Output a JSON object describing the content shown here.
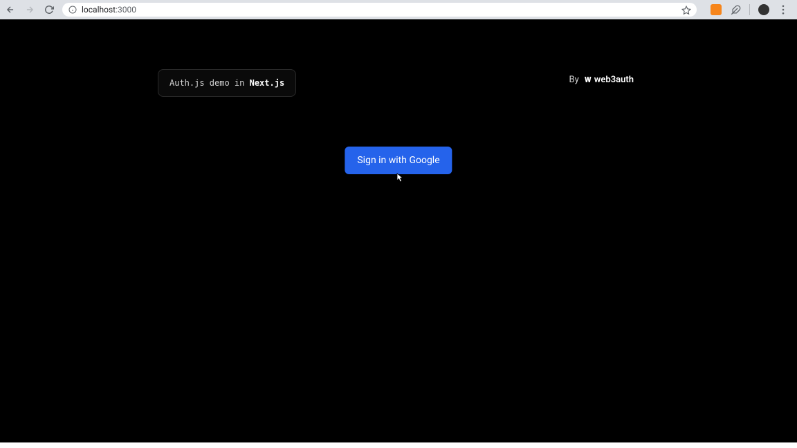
{
  "browser": {
    "url_host": "localhost",
    "url_port": ":3000"
  },
  "badge": {
    "prefix": "Auth.js demo in ",
    "bold": "Next.js"
  },
  "credit": {
    "by": "By",
    "brand": "web3auth"
  },
  "signin": {
    "label": "Sign in with Google"
  }
}
